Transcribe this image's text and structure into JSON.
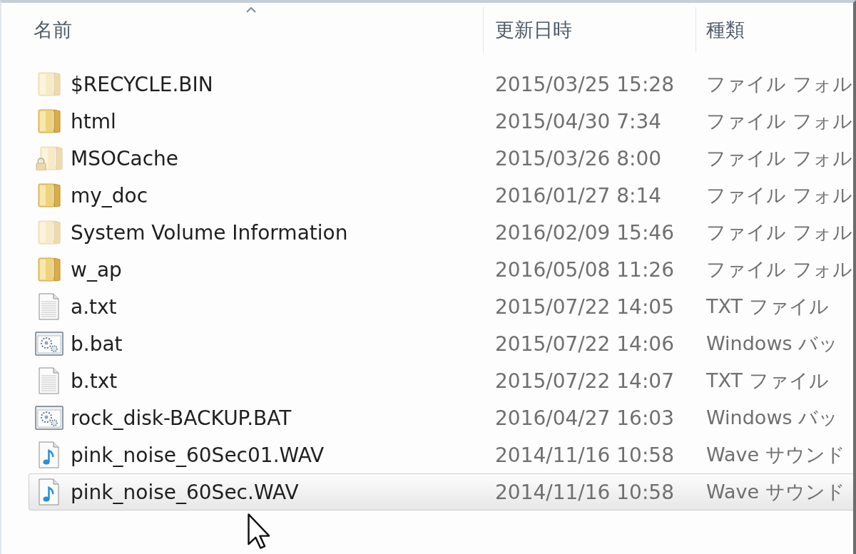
{
  "columns": [
    {
      "label": "名前",
      "sorted": true
    },
    {
      "label": "更新日時",
      "sorted": false
    },
    {
      "label": "種類",
      "sorted": false
    }
  ],
  "rows": [
    {
      "kind": "folder",
      "name": "$RECYCLE.BIN",
      "modified": "2015/03/25 15:28",
      "type": "ファイル フォル",
      "hidden": true,
      "locked": false,
      "selected": false
    },
    {
      "kind": "folder",
      "name": "html",
      "modified": "2015/04/30 7:34",
      "type": "ファイル フォル",
      "hidden": false,
      "locked": false,
      "selected": false
    },
    {
      "kind": "folder",
      "name": "MSOCache",
      "modified": "2015/03/26 8:00",
      "type": "ファイル フォル",
      "hidden": true,
      "locked": true,
      "selected": false
    },
    {
      "kind": "folder",
      "name": "my_doc",
      "modified": "2016/01/27 8:14",
      "type": "ファイル フォル",
      "hidden": false,
      "locked": false,
      "selected": false
    },
    {
      "kind": "folder",
      "name": "System Volume Information",
      "modified": "2016/02/09 15:46",
      "type": "ファイル フォル",
      "hidden": true,
      "locked": false,
      "selected": false
    },
    {
      "kind": "folder",
      "name": "w_ap",
      "modified": "2016/05/08 11:26",
      "type": "ファイル フォル",
      "hidden": false,
      "locked": false,
      "selected": false
    },
    {
      "kind": "text",
      "name": "a.txt",
      "modified": "2015/07/22 14:05",
      "type": "TXT ファイル",
      "hidden": false,
      "locked": false,
      "selected": false
    },
    {
      "kind": "batch",
      "name": "b.bat",
      "modified": "2015/07/22 14:06",
      "type": "Windows バッ",
      "hidden": false,
      "locked": false,
      "selected": false
    },
    {
      "kind": "text",
      "name": "b.txt",
      "modified": "2015/07/22 14:07",
      "type": "TXT ファイル",
      "hidden": false,
      "locked": false,
      "selected": false
    },
    {
      "kind": "batch",
      "name": "rock_disk-BACKUP.BAT",
      "modified": "2016/04/27 16:03",
      "type": "Windows バッ",
      "hidden": false,
      "locked": false,
      "selected": false
    },
    {
      "kind": "audio",
      "name": "pink_noise_60Sec01.WAV",
      "modified": "2014/11/16 10:58",
      "type": "Wave サウンド",
      "hidden": false,
      "locked": false,
      "selected": false
    },
    {
      "kind": "audio",
      "name": "pink_noise_60Sec.WAV",
      "modified": "2014/11/16 10:58",
      "type": "Wave サウンド",
      "hidden": false,
      "locked": false,
      "selected": true
    }
  ]
}
